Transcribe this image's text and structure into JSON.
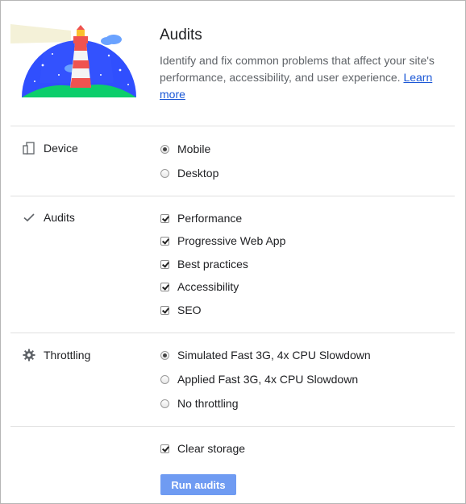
{
  "header": {
    "title": "Audits",
    "description": "Identify and fix common problems that affect your site's performance, accessibility, and user experience.",
    "learn_more": "Learn more",
    "logo_icon": "lighthouse-logo"
  },
  "sections": {
    "device": {
      "label": "Device",
      "icon": "device-icon",
      "options": [
        {
          "label": "Mobile",
          "checked": true
        },
        {
          "label": "Desktop",
          "checked": false
        }
      ]
    },
    "audits": {
      "label": "Audits",
      "icon": "checkmark-icon",
      "options": [
        {
          "label": "Performance",
          "checked": true
        },
        {
          "label": "Progressive Web App",
          "checked": true
        },
        {
          "label": "Best practices",
          "checked": true
        },
        {
          "label": "Accessibility",
          "checked": true
        },
        {
          "label": "SEO",
          "checked": true
        }
      ]
    },
    "throttling": {
      "label": "Throttling",
      "icon": "gear-icon",
      "options": [
        {
          "label": "Simulated Fast 3G, 4x CPU Slowdown",
          "checked": true
        },
        {
          "label": "Applied Fast 3G, 4x CPU Slowdown",
          "checked": false
        },
        {
          "label": "No throttling",
          "checked": false
        }
      ]
    }
  },
  "clear_storage": {
    "label": "Clear storage",
    "checked": true
  },
  "run_button": {
    "label": "Run audits",
    "color": "#6f9bf2"
  },
  "colors": {
    "link": "#1a57d6",
    "divider": "#e0e0e0",
    "logo_sky": "#304ffe"
  }
}
